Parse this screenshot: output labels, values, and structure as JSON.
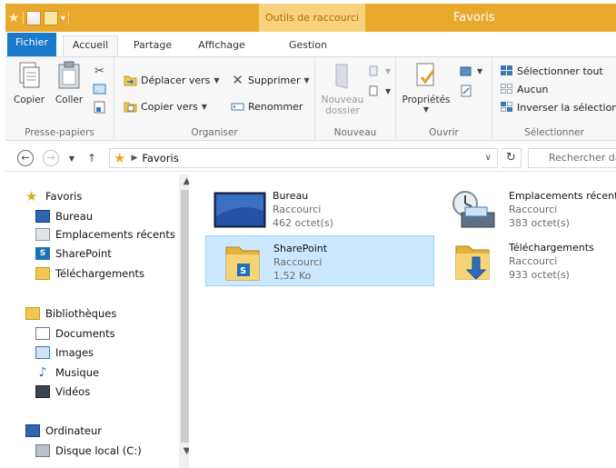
{
  "titlebar": {
    "context_tab": "Outils de raccourci",
    "title": "Favoris",
    "accent_color": "#e9a92e"
  },
  "tabs": {
    "file": "Fichier",
    "home": "Accueil",
    "share": "Partage",
    "view": "Affichage",
    "manage": "Gestion"
  },
  "ribbon": {
    "clipboard": {
      "copy": "Copier",
      "paste": "Coller",
      "label": "Presse-papiers"
    },
    "organize": {
      "move_to": "Déplacer vers",
      "copy_to": "Copier vers",
      "delete": "Supprimer",
      "rename": "Renommer",
      "label": "Organiser"
    },
    "new": {
      "new_folder_line1": "Nouveau",
      "new_folder_line2": "dossier",
      "label": "Nouveau"
    },
    "open": {
      "properties": "Propriétés",
      "label": "Ouvrir"
    },
    "select": {
      "select_all": "Sélectionner tout",
      "select_none": "Aucun",
      "invert": "Inverser la sélection",
      "label": "Sélectionner"
    }
  },
  "address": {
    "crumb": "Favoris",
    "search_placeholder": "Rechercher dans : Favoris"
  },
  "navpane": {
    "favorites": "Favoris",
    "fav_items": [
      "Bureau",
      "Emplacements récents",
      "SharePoint",
      "Téléchargements"
    ],
    "libraries": "Bibliothèques",
    "lib_items": [
      "Documents",
      "Images",
      "Musique",
      "Vidéos"
    ],
    "computer": "Ordinateur",
    "computer_items": [
      "Disque local (C:)"
    ]
  },
  "files": [
    {
      "name": "Bureau",
      "type": "Raccourci",
      "size": "462 octet(s)",
      "icon": "desktop-icon",
      "selected": false
    },
    {
      "name": "Emplacements récents",
      "type": "Raccourci",
      "size": "383 octet(s)",
      "icon": "recent-places-icon",
      "selected": false
    },
    {
      "name": "SharePoint",
      "type": "Raccourci",
      "size": "1,52 Ko",
      "icon": "sharepoint-folder-icon",
      "selected": true
    },
    {
      "name": "Téléchargements",
      "type": "Raccourci",
      "size": "933 octet(s)",
      "icon": "downloads-folder-icon",
      "selected": false
    }
  ]
}
